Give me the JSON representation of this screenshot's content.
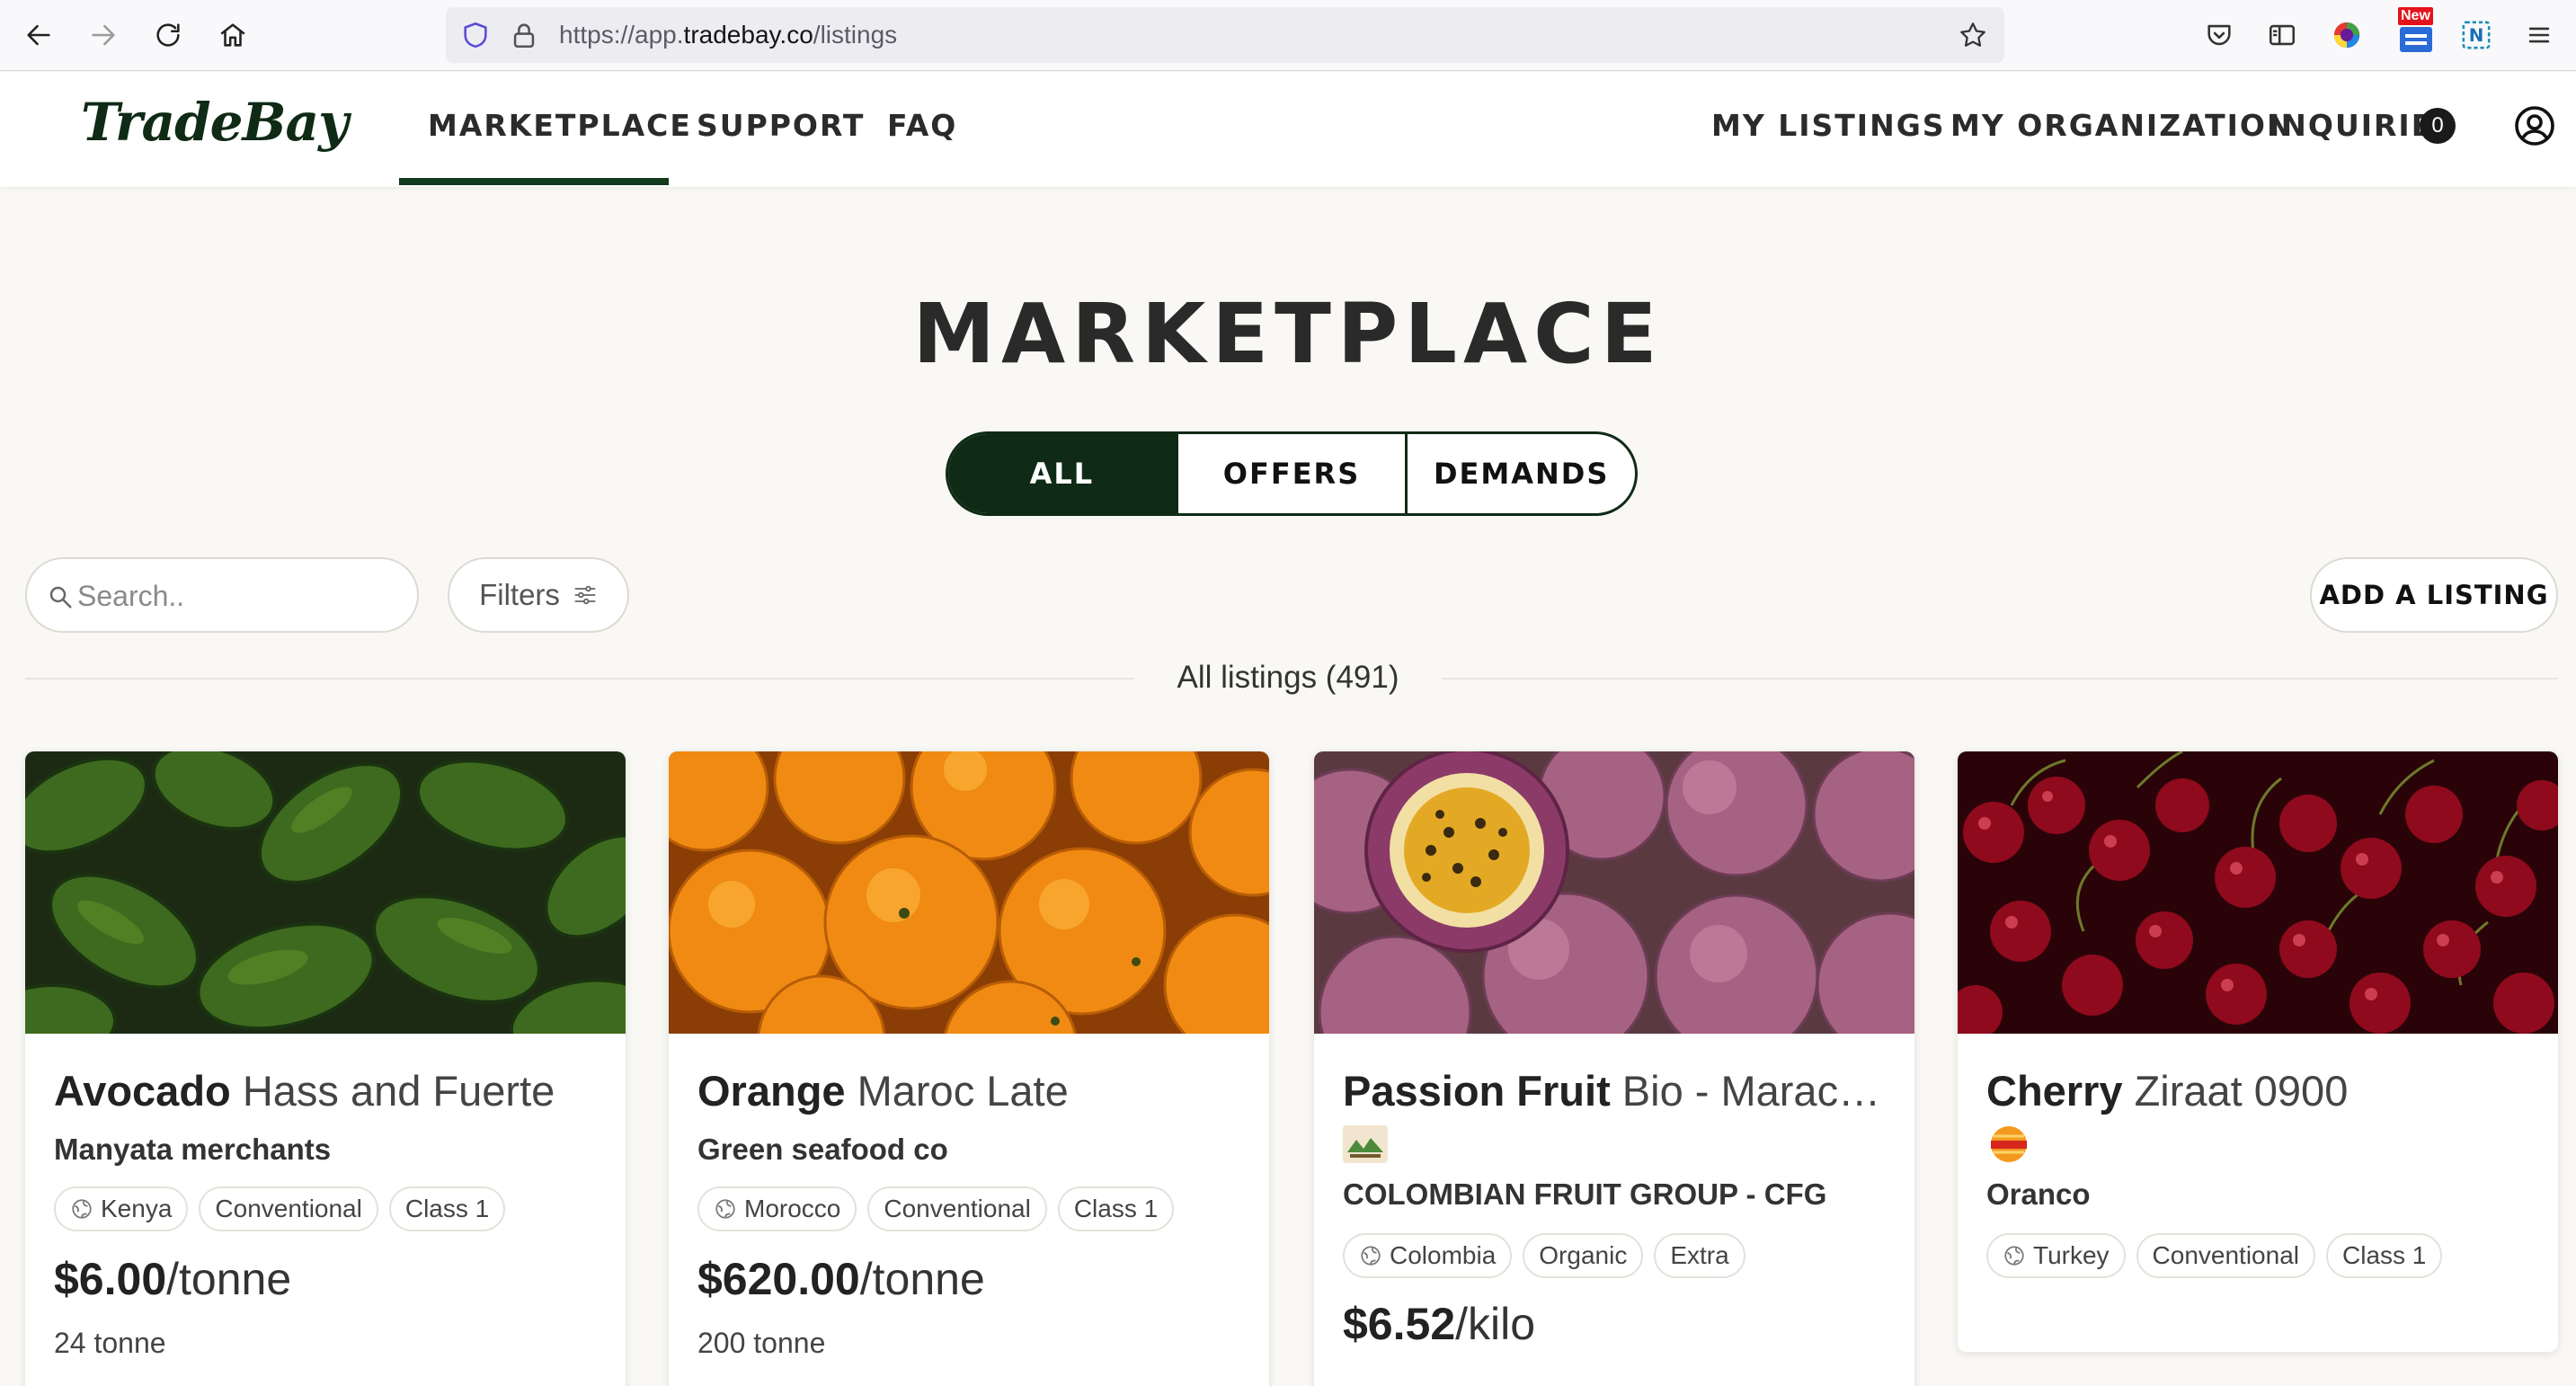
{
  "browser": {
    "url_prefix": "https://app.",
    "url_domain": "tradebay.co",
    "url_path": "/listings",
    "ext_new_label": "New",
    "ext_n_label": "N"
  },
  "header": {
    "logo": "TradeBay",
    "nav_left": [
      "MARKETPLACE",
      "SUPPORT",
      "FAQ"
    ],
    "nav_right": [
      "MY LISTINGS",
      "MY ORGANIZATION",
      "INQUIRIES"
    ],
    "inquiries_count": "0",
    "active_nav": "MARKETPLACE"
  },
  "page": {
    "title": "MARKETPLACE",
    "segments": [
      "ALL",
      "OFFERS",
      "DEMANDS"
    ],
    "active_segment": "ALL",
    "search_placeholder": "Search..",
    "filters_label": "Filters",
    "add_listing_label": "ADD A LISTING",
    "listings_count_label": "All listings (491)"
  },
  "colors": {
    "brand_dark_green": "#0f2a15",
    "background": "#f9f8f4"
  },
  "listings": [
    {
      "product": "Avocado",
      "variety": "Hass and Fuerte",
      "company": "Manyata merchants",
      "tags": [
        "Kenya",
        "Conventional",
        "Class 1"
      ],
      "price": "$6.00",
      "unit": "/tonne",
      "quantity": "24 tonne"
    },
    {
      "product": "Orange",
      "variety": "Maroc Late",
      "company": "Green seafood co",
      "tags": [
        "Morocco",
        "Conventional",
        "Class 1"
      ],
      "price": "$620.00",
      "unit": "/tonne",
      "quantity": "200 tonne"
    },
    {
      "product": "Passion Fruit",
      "variety": "Bio - Maracuya",
      "company": "COLOMBIAN FRUIT GROUP - CFG",
      "tags": [
        "Colombia",
        "Organic",
        "Extra"
      ],
      "price": "$6.52",
      "unit": "/kilo",
      "quantity": ""
    },
    {
      "product": "Cherry",
      "variety": "Ziraat 0900",
      "company": "Oranco",
      "tags": [
        "Turkey",
        "Conventional",
        "Class 1"
      ],
      "price": "",
      "unit": "",
      "quantity": ""
    }
  ]
}
